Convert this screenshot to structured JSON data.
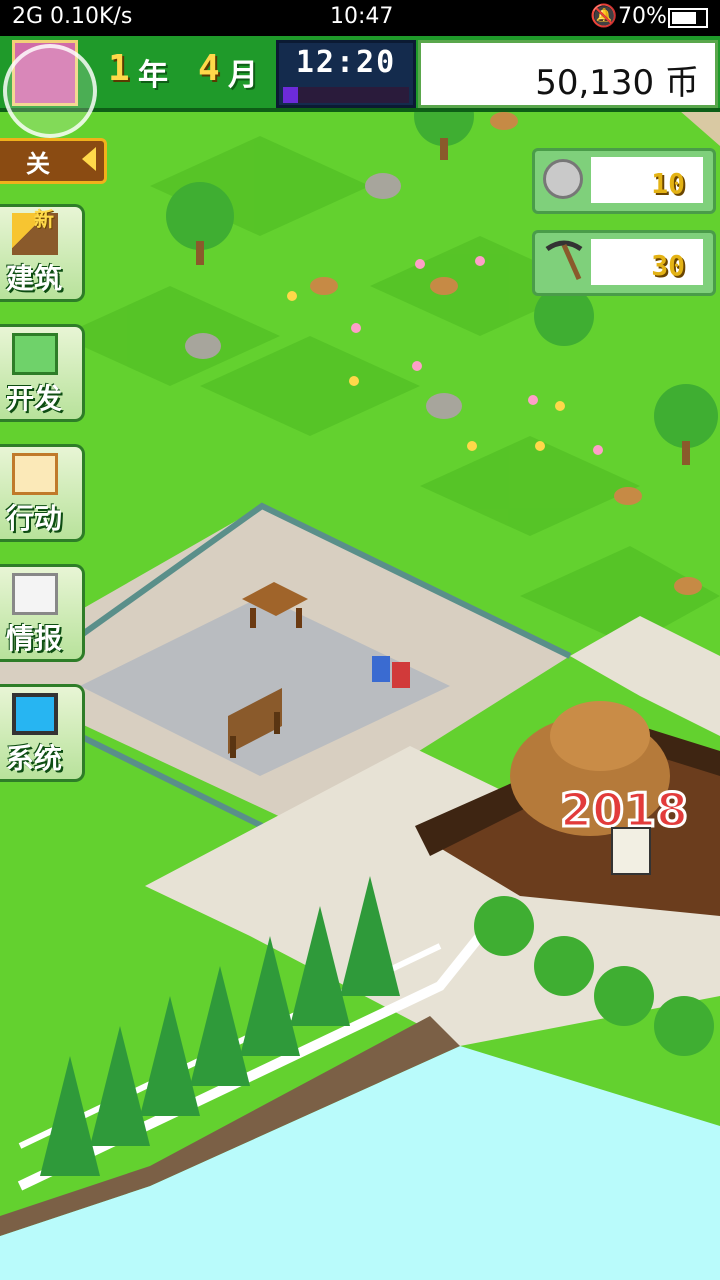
{
  "status": {
    "signal": "2G",
    "speed": "0.10K/s",
    "time": "10:47",
    "battery": "70%"
  },
  "top": {
    "year_num": "1",
    "year_unit": "年",
    "month_num": "4",
    "month_unit": "月",
    "clock": "12:20",
    "time_progress": 0.12,
    "money": "50,130",
    "currency": "币"
  },
  "close_label": "关",
  "menu": [
    {
      "label": "建筑",
      "badge": "新",
      "icon": "hammer-icon"
    },
    {
      "label": "开发",
      "icon": "clipboard-icon"
    },
    {
      "label": "行动",
      "icon": "notepad-icon"
    },
    {
      "label": "情报",
      "icon": "magnifier-icon"
    },
    {
      "label": "系统",
      "icon": "monitor-icon"
    }
  ],
  "resources": [
    {
      "icon": "coin-icon",
      "value": "10"
    },
    {
      "icon": "pickaxe-icon",
      "value": "30"
    }
  ],
  "signboard_text": "2018"
}
